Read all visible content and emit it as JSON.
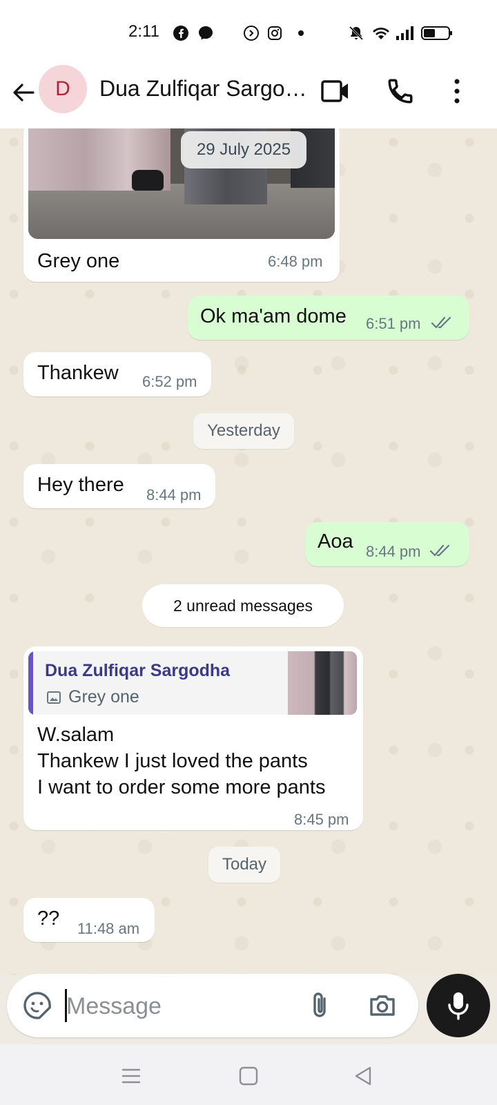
{
  "status_bar": {
    "time": "2:11",
    "icons": [
      "facebook-icon",
      "messenger-icon",
      "shazam-icon",
      "instagram-icon",
      "dot-icon",
      "mute-icon",
      "wifi-icon",
      "signal-icon",
      "battery-icon"
    ]
  },
  "header": {
    "avatar_letter": "D",
    "contact_name": "Dua Zulfiqar Sargodha",
    "colors": {
      "avatar_bg": "#f6d5d8",
      "avatar_fg": "#b0243a"
    }
  },
  "chat": {
    "image_message": {
      "caption": "Grey one",
      "time": "6:48 pm",
      "date_overlay": "29 July 2025"
    },
    "msg_ok": {
      "text": "Ok ma'am dome",
      "time": "6:51 pm"
    },
    "msg_thankew": {
      "text": "Thankew",
      "time": "6:52 pm"
    },
    "divider_yesterday": "Yesterday",
    "msg_hey": {
      "text": "Hey there",
      "time": "8:44 pm"
    },
    "msg_aoa": {
      "text": "Aoa",
      "time": "8:44 pm"
    },
    "unread_banner": "2 unread messages",
    "reply_message": {
      "quoted_name": "Dua Zulfiqar Sargodha",
      "quoted_text": "Grey one",
      "lines": [
        "W.salam",
        "Thankew I just loved the pants",
        "I want to order some more pants"
      ],
      "time": "8:45 pm"
    },
    "divider_today": "Today",
    "msg_qq": {
      "text": "??",
      "time": "11:48 am"
    }
  },
  "composer": {
    "placeholder": "Message"
  },
  "colors": {
    "outgoing_bubble": "#d9fdd3",
    "incoming_bubble": "#ffffff",
    "read_ticks": "#53bdeb",
    "quote_bar": "#6a4fd8",
    "quote_name": "#3b3a8a"
  }
}
